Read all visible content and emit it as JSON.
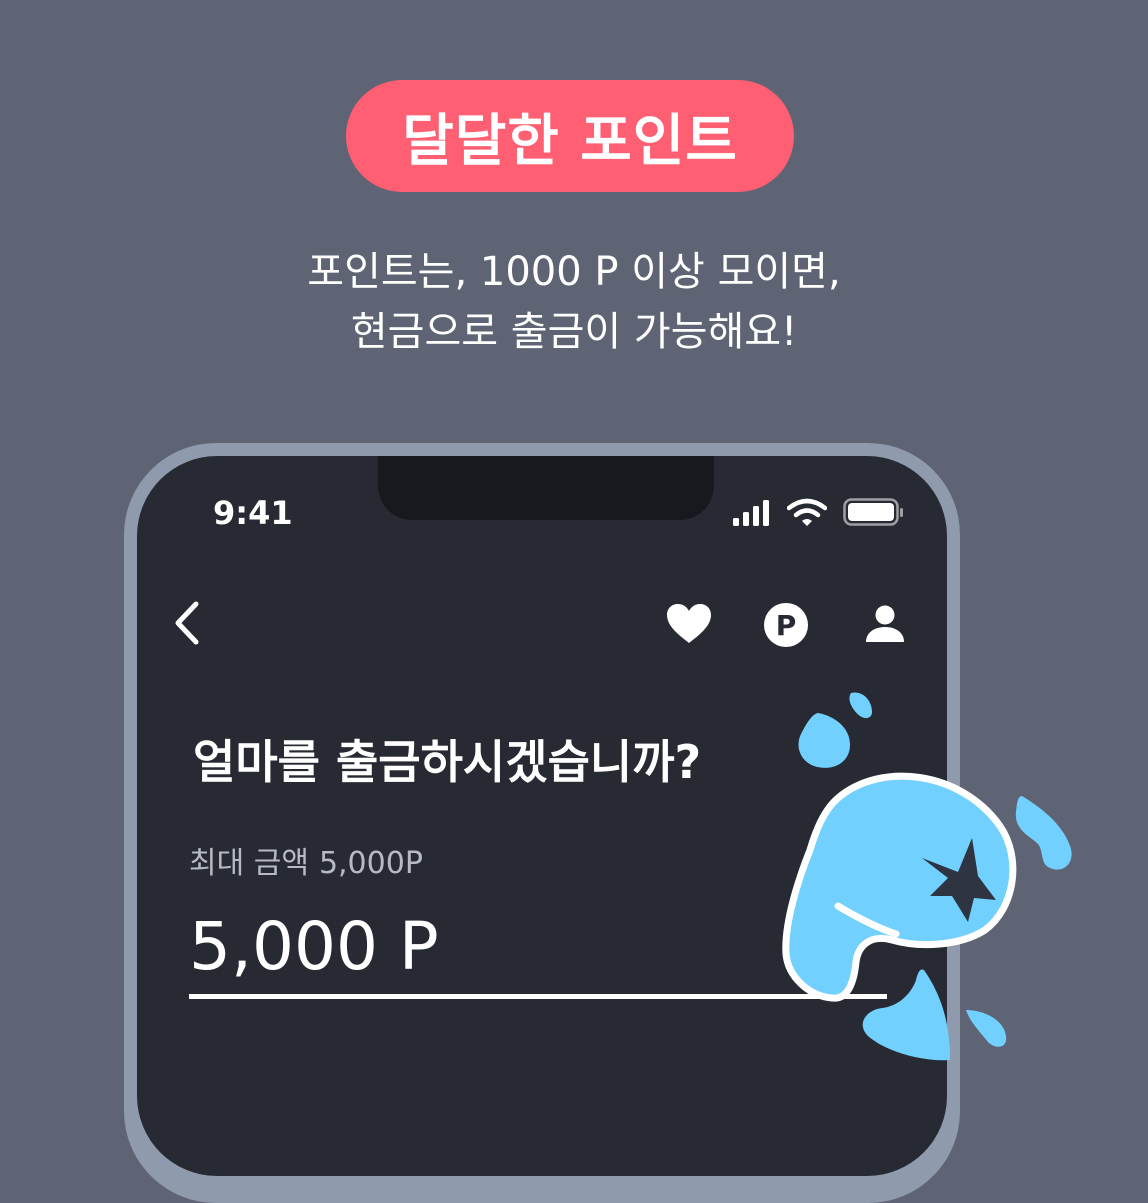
{
  "banner": {
    "title": "달달한 포인트",
    "caption_line1": "포인트는, 1000 P 이상 모이면,",
    "caption_line2": "현금으로 출금이 가능해요!"
  },
  "status_bar": {
    "time": "9:41",
    "icons": [
      "signal-icon",
      "wifi-icon",
      "battery-icon"
    ]
  },
  "nav": {
    "icons": [
      "back-icon",
      "heart-icon",
      "points-icon",
      "person-icon"
    ],
    "points_letter": "P"
  },
  "withdraw": {
    "question": "얼마를 출금하시겠습니까?",
    "max_label": "최대 금액",
    "max_value": "5,000P",
    "amount_value": "5,000 P"
  },
  "colors": {
    "background": "#5f6474",
    "banner_pill": "#ff5f72",
    "screen": "#272a33",
    "phone_frame": "#8f9aad",
    "mascot_blue": "#72d0ff"
  }
}
